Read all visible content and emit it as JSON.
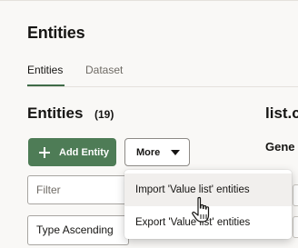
{
  "header": {
    "title": "Entities"
  },
  "tabs": [
    {
      "label": "Entities",
      "active": true
    },
    {
      "label": "Dataset",
      "active": false
    }
  ],
  "section": {
    "title": "Entities",
    "count": "(19)"
  },
  "detail": {
    "title": "list.c",
    "subheading": "Gene"
  },
  "toolbar": {
    "add_entity_label": "Add Entity",
    "more_label": "More"
  },
  "filter": {
    "placeholder": "Filter",
    "value": ""
  },
  "sort": {
    "selected": "Type Ascending"
  },
  "more_menu": {
    "items": [
      {
        "label": "Import 'Value list' entities"
      },
      {
        "label": "Export 'Value list' entities"
      }
    ]
  },
  "colors": {
    "accent": "#4e7c56",
    "tab_underline": "#3f6b48",
    "background": "#f9f8f6"
  }
}
